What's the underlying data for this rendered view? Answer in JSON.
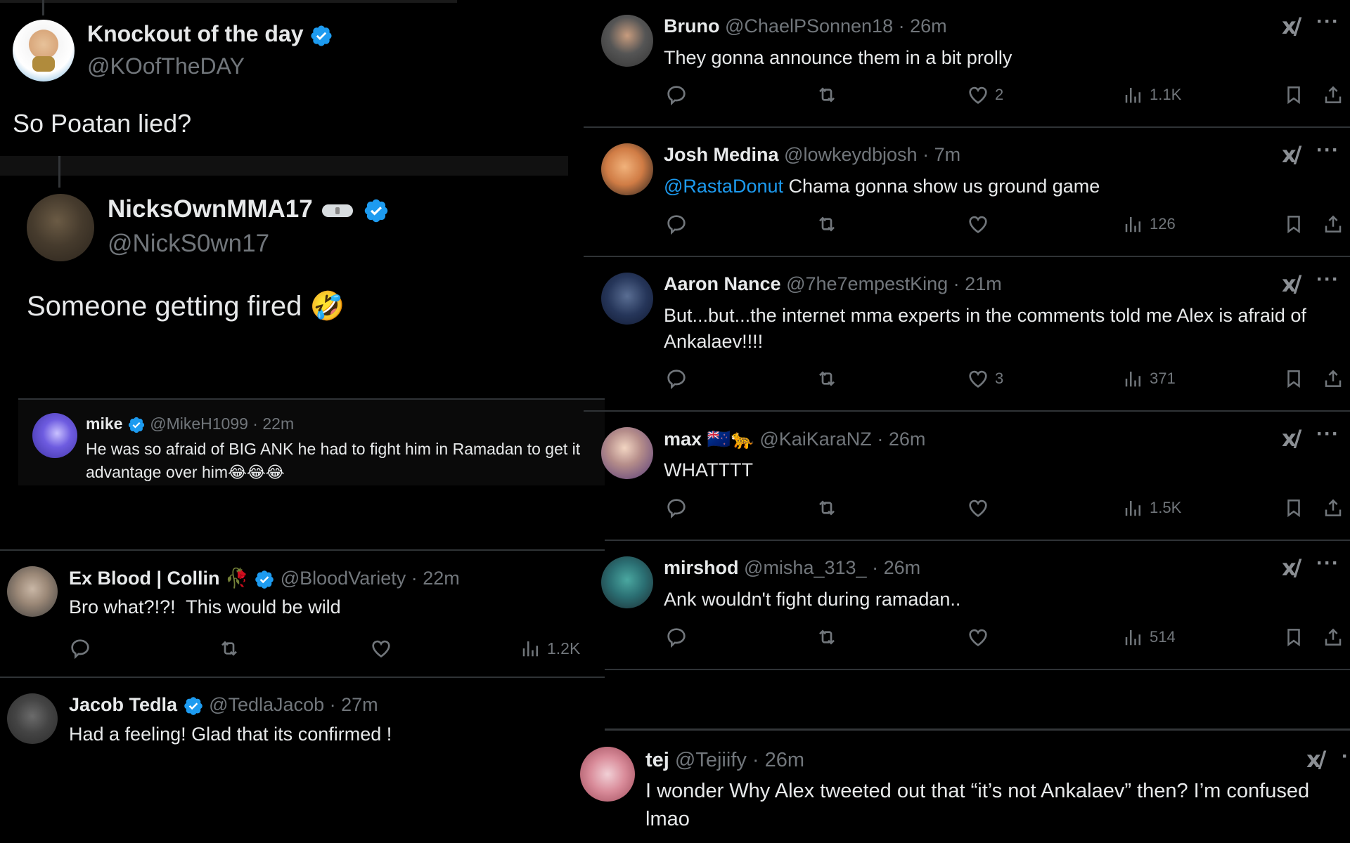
{
  "left": {
    "main_tweet": {
      "name": "Knockout of the day",
      "handle": "@KOofTheDAY",
      "verified": true,
      "text": "So Poatan lied?"
    },
    "quoted_tweet": {
      "name": "NicksOwnMMA17",
      "name_emoji": "goggles-emoji",
      "handle": "@NickS0wn17",
      "verified": true,
      "text": "Someone getting fired",
      "text_emoji": "🤣"
    },
    "inner_quote": {
      "name": "mike",
      "verified": true,
      "handle": "@MikeH1099",
      "time": "22m",
      "text": "He was so afraid of BIG ANK he had to fight him in Ramadan to get it advantage over him",
      "text_emoji": "😂😂😂"
    },
    "replies": [
      {
        "name": "Ex Blood | Collin",
        "name_emoji": "🥀",
        "verified": true,
        "handle": "@BloodVariety",
        "time": "22m",
        "text": "Bro what?!?!  This would be wild",
        "views": "1.2K"
      },
      {
        "name": "Jacob Tedla",
        "verified": true,
        "handle": "@TedlaJacob",
        "time": "27m",
        "text": "Had a feeling! Glad that its confirmed !"
      }
    ]
  },
  "right": {
    "replies": [
      {
        "name": "Bruno",
        "handle": "@ChaelPSonnen18",
        "time": "26m",
        "text": "They gonna announce them in a bit prolly",
        "likes": "2",
        "views": "1.1K"
      },
      {
        "name": "Josh Medina",
        "handle": "@lowkeydbjosh",
        "time": "7m",
        "mention": "@RastaDonut",
        "text": "Chama gonna show us ground game",
        "likes": "",
        "views": "126"
      },
      {
        "name": "Aaron Nance",
        "handle": "@7he7empestKing",
        "time": "21m",
        "text": "But...but...the internet mma experts in the comments told me Alex is afraid of Ankalaev!!!!",
        "likes": "3",
        "views": "371"
      },
      {
        "name": "max",
        "name_emoji": "🇳🇿🐆",
        "handle": "@KaiKaraNZ",
        "time": "26m",
        "text": "WHATTTT",
        "likes": "",
        "views": "1.5K"
      },
      {
        "name": "mirshod",
        "handle": "@misha_313_",
        "time": "26m",
        "text": "Ank wouldn't fight during ramadan..",
        "likes": "",
        "views": "514"
      }
    ],
    "last_reply": {
      "name": "tej",
      "handle": "@Tejiify",
      "time": "26m",
      "text_line1": "I wonder Why Alex tweeted out that “it’s not Ankalaev” then? I’m confused",
      "text_line2": "lmao"
    }
  },
  "icons": {
    "grok": "Grok-icon",
    "more": "···",
    "separator": "·"
  },
  "colors": {
    "background": "#000000",
    "text": "#e7e9ea",
    "muted": "#71767b",
    "accent": "#1d9bf0"
  }
}
